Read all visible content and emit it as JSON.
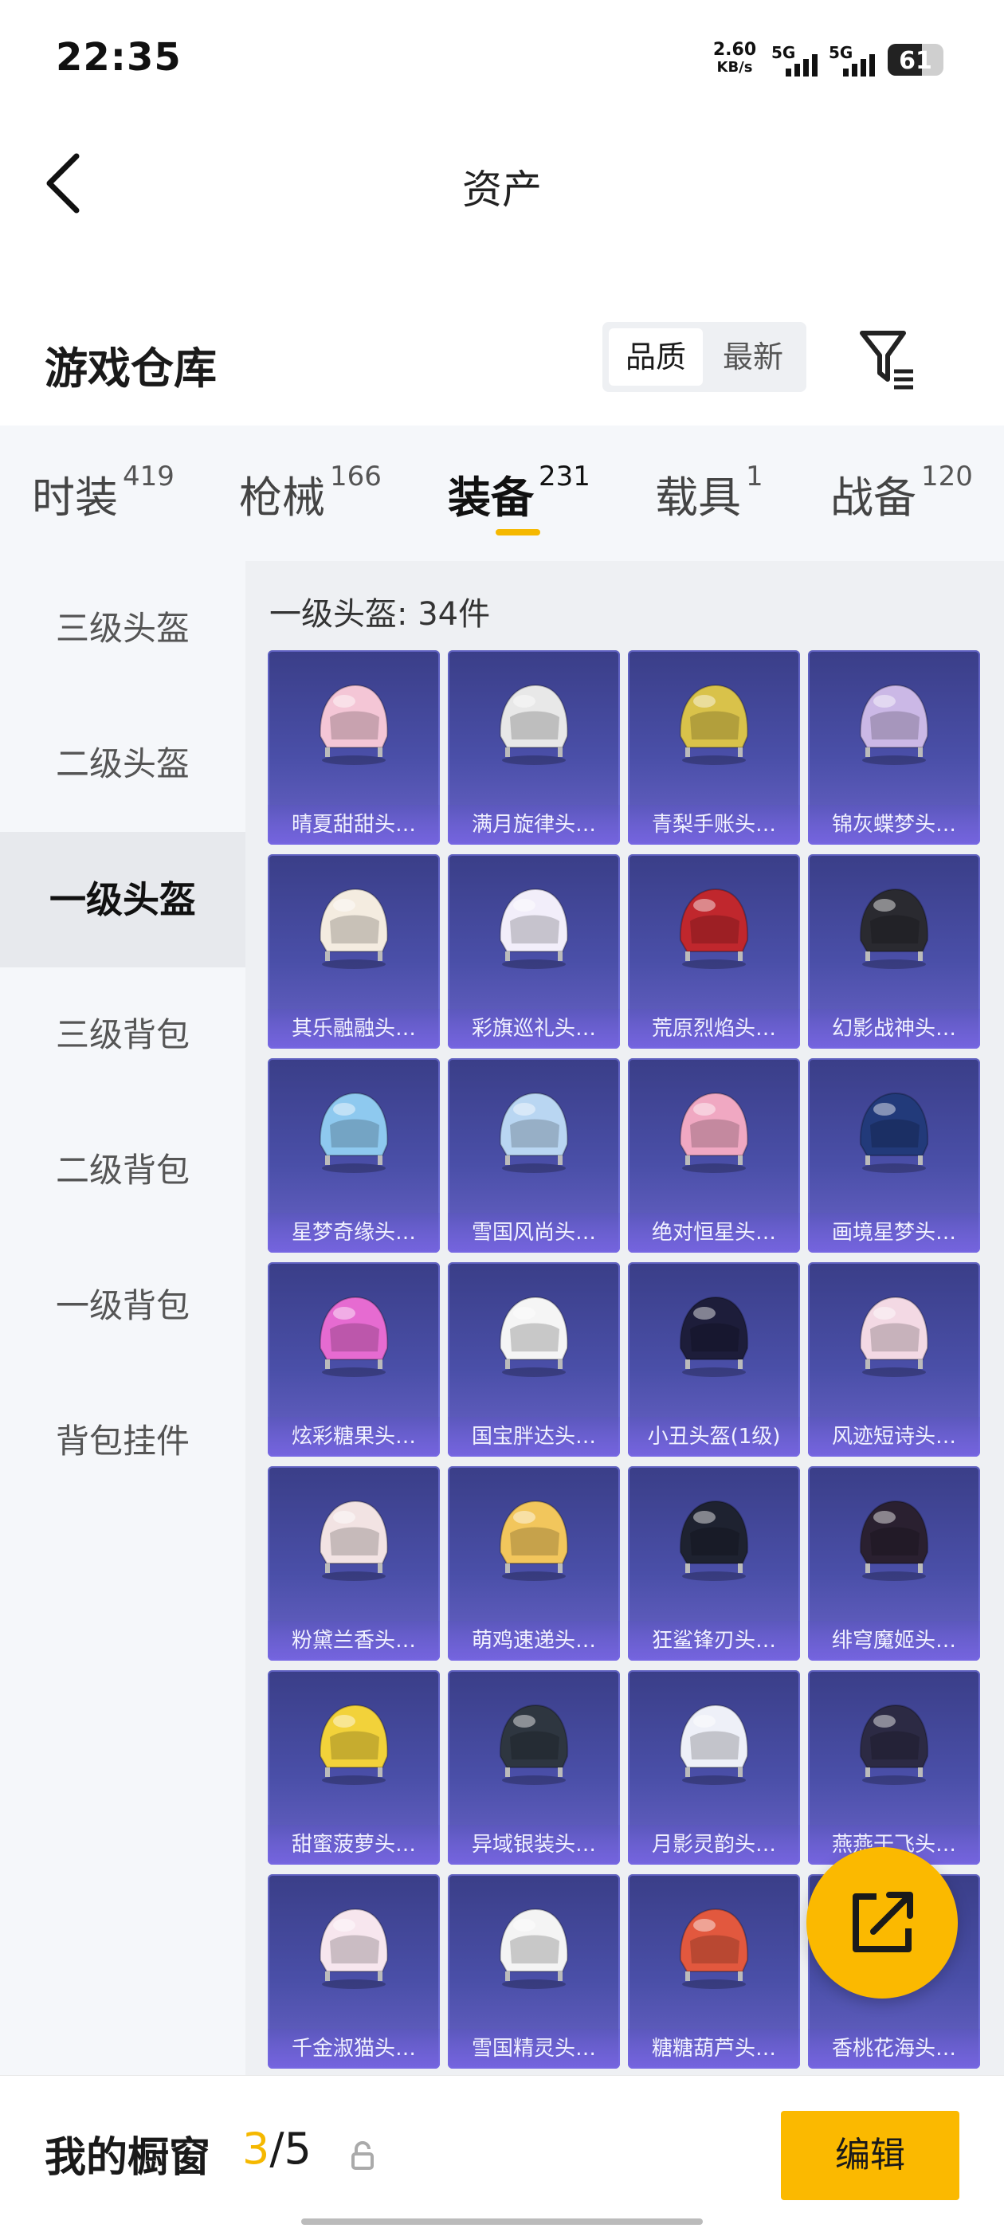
{
  "status_bar": {
    "time": "22:35",
    "net_speed": "2.60",
    "net_unit": "KB/s",
    "sim1": "5G",
    "sim2": "5G",
    "battery": "61",
    "battery_level": 0.61
  },
  "header": {
    "title": "资产",
    "back_icon": "chevron-left-icon"
  },
  "warehouse": {
    "title": "游戏仓库",
    "sort_options": [
      "品质",
      "最新"
    ],
    "sort_selected": "品质",
    "filter_icon": "filter-icon"
  },
  "tabs": [
    {
      "label": "时装",
      "count": "419"
    },
    {
      "label": "枪械",
      "count": "166"
    },
    {
      "label": "装备",
      "count": "231",
      "active": true
    },
    {
      "label": "载具",
      "count": "1"
    },
    {
      "label": "战备",
      "count": "120"
    }
  ],
  "sidebar": {
    "items": [
      "三级头盔",
      "二级头盔",
      "一级头盔",
      "三级背包",
      "二级背包",
      "一级背包",
      "背包挂件"
    ],
    "active_index": 2
  },
  "content": {
    "count_label": "一级头盔: 34件",
    "items": [
      {
        "name": "晴夏甜甜头…",
        "color": "#f4c6d6"
      },
      {
        "name": "满月旋律头…",
        "color": "#e8e8e8"
      },
      {
        "name": "青梨手账头…",
        "color": "#d9c24a"
      },
      {
        "name": "锦灰蝶梦头…",
        "color": "#cbb8e6"
      },
      {
        "name": "其乐融融头…",
        "color": "#f4ece0"
      },
      {
        "name": "彩旗巡礼头…",
        "color": "#f2eefa"
      },
      {
        "name": "荒原烈焰头…",
        "color": "#c0272d"
      },
      {
        "name": "幻影战神头…",
        "color": "#2a2a30"
      },
      {
        "name": "星梦奇缘头…",
        "color": "#8ec9ef"
      },
      {
        "name": "雪国风尚头…",
        "color": "#b9d6f2"
      },
      {
        "name": "绝对恒星头…",
        "color": "#f0a8c2"
      },
      {
        "name": "画境星梦头…",
        "color": "#223a7a"
      },
      {
        "name": "炫彩糖果头…",
        "color": "#e66bd1"
      },
      {
        "name": "国宝胖达头…",
        "color": "#f5f5f5"
      },
      {
        "name": "小丑头盔(1级)",
        "color": "#1d1d3a"
      },
      {
        "name": "风迹短诗头…",
        "color": "#f3d9e4"
      },
      {
        "name": "粉黛兰香头…",
        "color": "#f2e3e3"
      },
      {
        "name": "萌鸡速递头…",
        "color": "#f2c65c"
      },
      {
        "name": "狂鲨锋刃头…",
        "color": "#1e2230"
      },
      {
        "name": "绯穹魔姬头…",
        "color": "#2a2030"
      },
      {
        "name": "甜蜜菠萝头…",
        "color": "#f2d23a"
      },
      {
        "name": "异域银装头…",
        "color": "#2e3640"
      },
      {
        "name": "月影灵韵头…",
        "color": "#eef0f8"
      },
      {
        "name": "燕燕于飞头…",
        "color": "#2c2a44"
      },
      {
        "name": "千金淑猫头…",
        "color": "#f7e6ee"
      },
      {
        "name": "雪国精灵头…",
        "color": "#f4f4f4"
      },
      {
        "name": "糖糖葫芦头…",
        "color": "#e2583e"
      },
      {
        "name": "香桃花海头…",
        "color": "#f0b8c8"
      }
    ]
  },
  "fab": {
    "icon": "share-icon"
  },
  "bottom": {
    "label": "我的橱窗",
    "count_current": "3",
    "count_total": "/5",
    "lock_icon": "lock-icon",
    "edit_label": "编辑"
  }
}
